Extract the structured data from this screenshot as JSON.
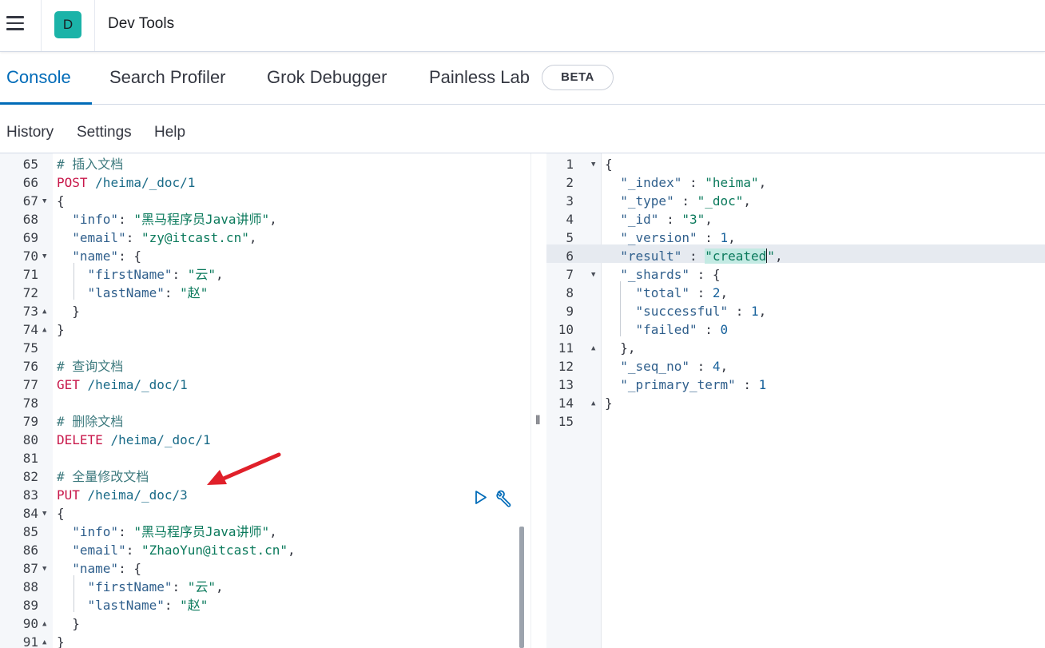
{
  "header": {
    "avatar_letter": "D",
    "app_title": "Dev Tools",
    "menu_icon": "hamburger-menu-icon"
  },
  "tabs": [
    {
      "label": "Console",
      "active": true
    },
    {
      "label": "Search Profiler",
      "active": false
    },
    {
      "label": "Grok Debugger",
      "active": false
    },
    {
      "label": "Painless Lab",
      "active": false
    }
  ],
  "beta_badge": "BETA",
  "menu": {
    "history": "History",
    "settings": "Settings",
    "help": "Help"
  },
  "colors": {
    "accent": "#006bb8",
    "avatar_bg": "#1bb3a8",
    "method": "#c8174a",
    "string": "#0b7a5c",
    "arrow": "#e0202a"
  },
  "editor": {
    "lines": [
      {
        "n": "65",
        "fold": "",
        "segs": [
          [
            "c-comment",
            "# 插入文档"
          ]
        ]
      },
      {
        "n": "66",
        "fold": "",
        "segs": [
          [
            "c-method",
            "POST "
          ],
          [
            "c-url",
            "/heima/_doc/1"
          ]
        ]
      },
      {
        "n": "67",
        "fold": "▼",
        "segs": [
          [
            "c-punc",
            "{"
          ]
        ]
      },
      {
        "n": "68",
        "fold": "",
        "segs": [
          [
            "c-punc",
            "  "
          ],
          [
            "c-key",
            "\"info\""
          ],
          [
            "c-punc",
            ": "
          ],
          [
            "c-str",
            "\"黑马程序员Java讲师\""
          ],
          [
            "c-punc",
            ","
          ]
        ]
      },
      {
        "n": "69",
        "fold": "",
        "segs": [
          [
            "c-punc",
            "  "
          ],
          [
            "c-key",
            "\"email\""
          ],
          [
            "c-punc",
            ": "
          ],
          [
            "c-str",
            "\"zy@itcast.cn\""
          ],
          [
            "c-punc",
            ","
          ]
        ]
      },
      {
        "n": "70",
        "fold": "▼",
        "segs": [
          [
            "c-punc",
            "  "
          ],
          [
            "c-key",
            "\"name\""
          ],
          [
            "c-punc",
            ": {"
          ]
        ]
      },
      {
        "n": "71",
        "fold": "",
        "segs": [
          [
            "c-punc",
            "    "
          ],
          [
            "c-key",
            "\"firstName\""
          ],
          [
            "c-punc",
            ": "
          ],
          [
            "c-str",
            "\"云\""
          ],
          [
            "c-punc",
            ","
          ]
        ]
      },
      {
        "n": "72",
        "fold": "",
        "segs": [
          [
            "c-punc",
            "    "
          ],
          [
            "c-key",
            "\"lastName\""
          ],
          [
            "c-punc",
            ": "
          ],
          [
            "c-str",
            "\"赵\""
          ]
        ]
      },
      {
        "n": "73",
        "fold": "▲",
        "segs": [
          [
            "c-punc",
            "  }"
          ]
        ]
      },
      {
        "n": "74",
        "fold": "▲",
        "segs": [
          [
            "c-punc",
            "}"
          ]
        ]
      },
      {
        "n": "75",
        "fold": "",
        "segs": []
      },
      {
        "n": "76",
        "fold": "",
        "segs": [
          [
            "c-comment",
            "# 查询文档"
          ]
        ]
      },
      {
        "n": "77",
        "fold": "",
        "segs": [
          [
            "c-method",
            "GET "
          ],
          [
            "c-url",
            "/heima/_doc/1"
          ]
        ]
      },
      {
        "n": "78",
        "fold": "",
        "segs": []
      },
      {
        "n": "79",
        "fold": "",
        "segs": [
          [
            "c-comment",
            "# 删除文档"
          ]
        ]
      },
      {
        "n": "80",
        "fold": "",
        "segs": [
          [
            "c-method",
            "DELETE "
          ],
          [
            "c-url",
            "/heima/_doc/1"
          ]
        ]
      },
      {
        "n": "81",
        "fold": "",
        "segs": []
      },
      {
        "n": "82",
        "fold": "",
        "segs": [
          [
            "c-comment",
            "# 全量修改文档"
          ]
        ]
      },
      {
        "n": "83",
        "fold": "",
        "segs": [
          [
            "c-method",
            "PUT "
          ],
          [
            "c-url",
            "/heima/_doc/3"
          ]
        ]
      },
      {
        "n": "84",
        "fold": "▼",
        "segs": [
          [
            "c-punc",
            "{"
          ]
        ]
      },
      {
        "n": "85",
        "fold": "",
        "segs": [
          [
            "c-punc",
            "  "
          ],
          [
            "c-key",
            "\"info\""
          ],
          [
            "c-punc",
            ": "
          ],
          [
            "c-str",
            "\"黑马程序员Java讲师\""
          ],
          [
            "c-punc",
            ","
          ]
        ]
      },
      {
        "n": "86",
        "fold": "",
        "segs": [
          [
            "c-punc",
            "  "
          ],
          [
            "c-key",
            "\"email\""
          ],
          [
            "c-punc",
            ": "
          ],
          [
            "c-str",
            "\"ZhaoYun@itcast.cn\""
          ],
          [
            "c-punc",
            ","
          ]
        ]
      },
      {
        "n": "87",
        "fold": "▼",
        "segs": [
          [
            "c-punc",
            "  "
          ],
          [
            "c-key",
            "\"name\""
          ],
          [
            "c-punc",
            ": {"
          ]
        ]
      },
      {
        "n": "88",
        "fold": "",
        "segs": [
          [
            "c-punc",
            "    "
          ],
          [
            "c-key",
            "\"firstName\""
          ],
          [
            "c-punc",
            ": "
          ],
          [
            "c-str",
            "\"云\""
          ],
          [
            "c-punc",
            ","
          ]
        ]
      },
      {
        "n": "89",
        "fold": "",
        "segs": [
          [
            "c-punc",
            "    "
          ],
          [
            "c-key",
            "\"lastName\""
          ],
          [
            "c-punc",
            ": "
          ],
          [
            "c-str",
            "\"赵\""
          ]
        ]
      },
      {
        "n": "90",
        "fold": "▲",
        "segs": [
          [
            "c-punc",
            "  }"
          ]
        ]
      },
      {
        "n": "91",
        "fold": "▲",
        "segs": [
          [
            "c-punc",
            "}"
          ]
        ]
      }
    ]
  },
  "output": {
    "lines": [
      {
        "n": "1",
        "fold": "▼",
        "segs": [
          [
            "c-punc",
            "{"
          ]
        ]
      },
      {
        "n": "2",
        "fold": "",
        "segs": [
          [
            "c-punc",
            "  "
          ],
          [
            "c-key",
            "\"_index\""
          ],
          [
            "c-punc",
            " : "
          ],
          [
            "c-str",
            "\"heima\""
          ],
          [
            "c-punc",
            ","
          ]
        ]
      },
      {
        "n": "3",
        "fold": "",
        "segs": [
          [
            "c-punc",
            "  "
          ],
          [
            "c-key",
            "\"_type\""
          ],
          [
            "c-punc",
            " : "
          ],
          [
            "c-str",
            "\"_doc\""
          ],
          [
            "c-punc",
            ","
          ]
        ]
      },
      {
        "n": "4",
        "fold": "",
        "segs": [
          [
            "c-punc",
            "  "
          ],
          [
            "c-key",
            "\"_id\""
          ],
          [
            "c-punc",
            " : "
          ],
          [
            "c-str",
            "\"3\""
          ],
          [
            "c-punc",
            ","
          ]
        ]
      },
      {
        "n": "5",
        "fold": "",
        "segs": [
          [
            "c-punc",
            "  "
          ],
          [
            "c-key",
            "\"_version\""
          ],
          [
            "c-punc",
            " : "
          ],
          [
            "c-num",
            "1"
          ],
          [
            "c-punc",
            ","
          ]
        ]
      },
      {
        "n": "6",
        "fold": "",
        "segs": [
          [
            "c-punc",
            "  "
          ],
          [
            "c-key",
            "\"result\""
          ],
          [
            "c-punc",
            " : "
          ],
          [
            "c-str hl-word",
            "\"created"
          ],
          [
            "cursor",
            ""
          ],
          [
            "c-str",
            "\""
          ],
          [
            "c-punc",
            ","
          ]
        ]
      },
      {
        "n": "7",
        "fold": "▼",
        "segs": [
          [
            "c-punc",
            "  "
          ],
          [
            "c-key",
            "\"_shards\""
          ],
          [
            "c-punc",
            " : {"
          ]
        ]
      },
      {
        "n": "8",
        "fold": "",
        "segs": [
          [
            "c-punc",
            "    "
          ],
          [
            "c-key",
            "\"total\""
          ],
          [
            "c-punc",
            " : "
          ],
          [
            "c-num",
            "2"
          ],
          [
            "c-punc",
            ","
          ]
        ]
      },
      {
        "n": "9",
        "fold": "",
        "segs": [
          [
            "c-punc",
            "    "
          ],
          [
            "c-key",
            "\"successful\""
          ],
          [
            "c-punc",
            " : "
          ],
          [
            "c-num",
            "1"
          ],
          [
            "c-punc",
            ","
          ]
        ]
      },
      {
        "n": "10",
        "fold": "",
        "segs": [
          [
            "c-punc",
            "    "
          ],
          [
            "c-key",
            "\"failed\""
          ],
          [
            "c-punc",
            " : "
          ],
          [
            "c-num",
            "0"
          ]
        ]
      },
      {
        "n": "11",
        "fold": "▲",
        "segs": [
          [
            "c-punc",
            "  },"
          ]
        ]
      },
      {
        "n": "12",
        "fold": "",
        "segs": [
          [
            "c-punc",
            "  "
          ],
          [
            "c-key",
            "\"_seq_no\""
          ],
          [
            "c-punc",
            " : "
          ],
          [
            "c-num",
            "4"
          ],
          [
            "c-punc",
            ","
          ]
        ]
      },
      {
        "n": "13",
        "fold": "",
        "segs": [
          [
            "c-punc",
            "  "
          ],
          [
            "c-key",
            "\"_primary_term\""
          ],
          [
            "c-punc",
            " : "
          ],
          [
            "c-num",
            "1"
          ]
        ]
      },
      {
        "n": "14",
        "fold": "▲",
        "segs": [
          [
            "c-punc",
            "}"
          ]
        ]
      },
      {
        "n": "15",
        "fold": "",
        "segs": []
      }
    ]
  }
}
